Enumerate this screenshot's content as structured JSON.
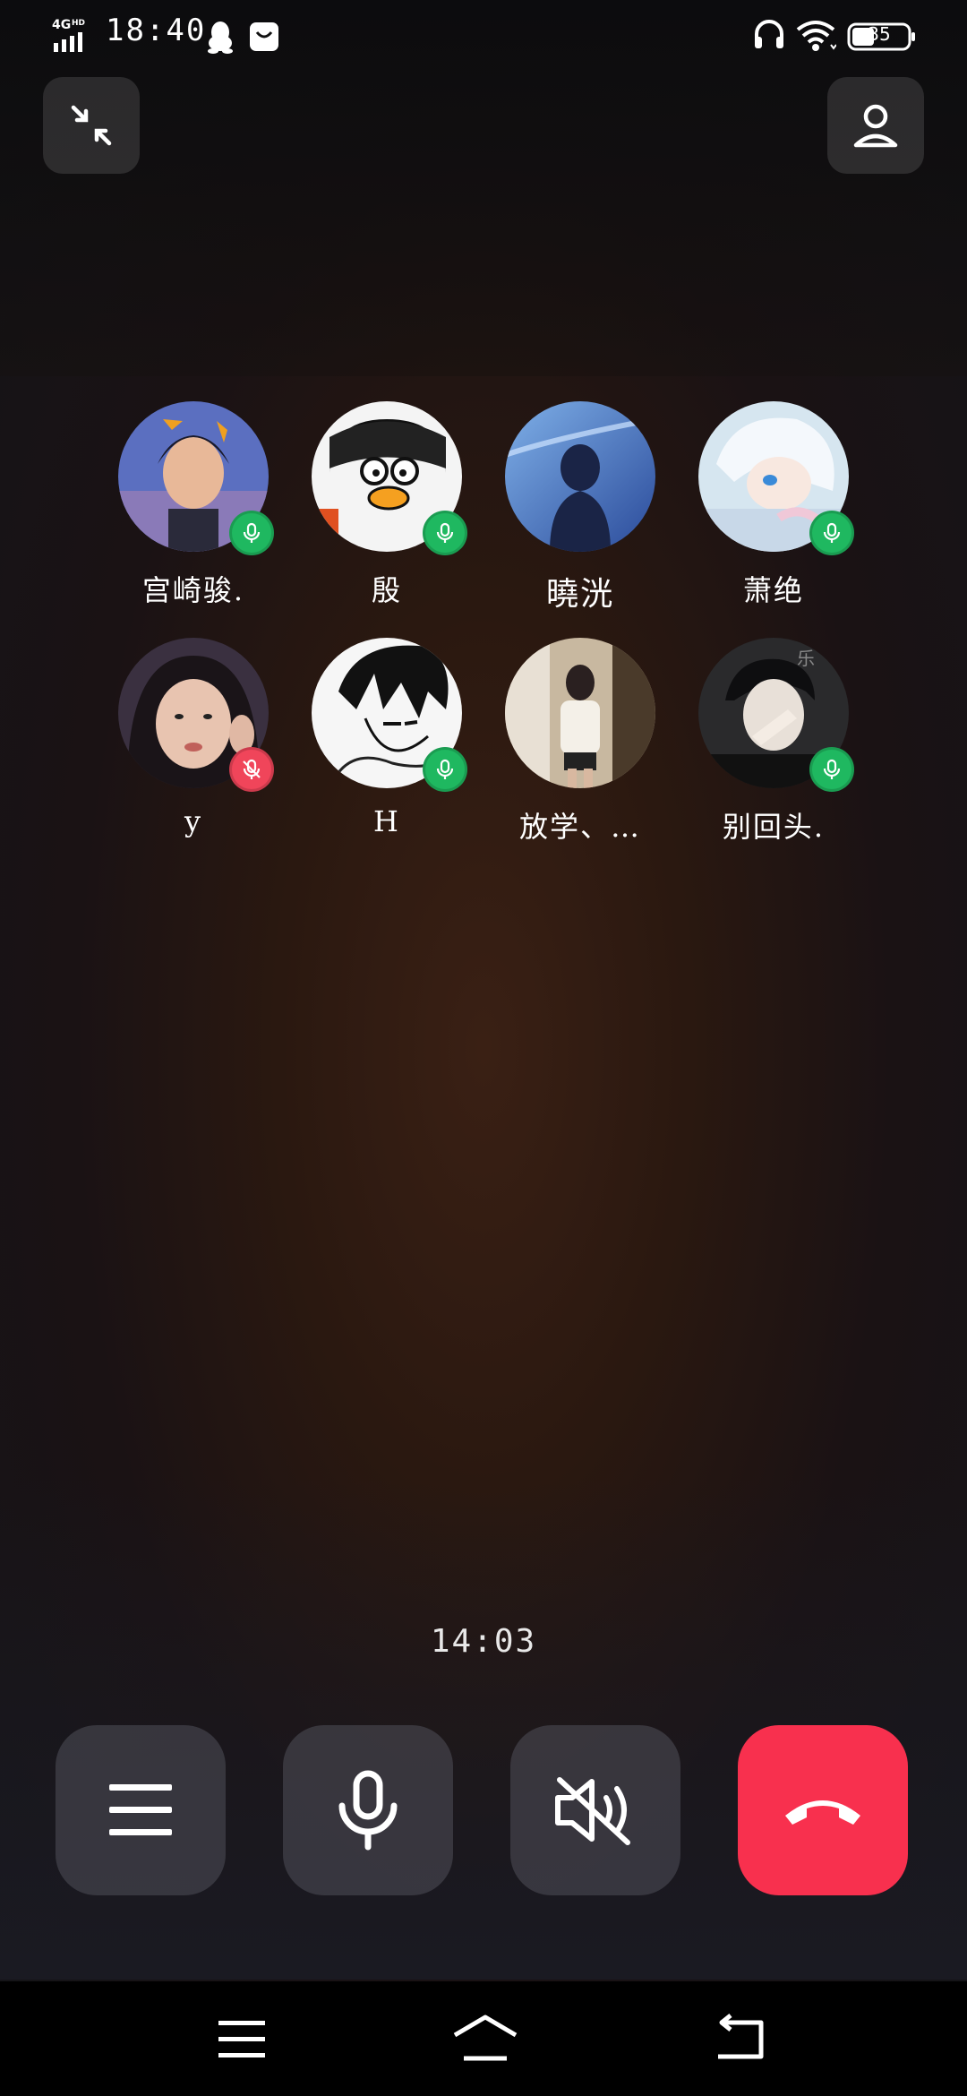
{
  "status_bar": {
    "network": "4G HD",
    "time": "18:40",
    "battery": "35",
    "icons": [
      "signal-icon",
      "qq-icon",
      "message-icon",
      "headset-icon",
      "wifi-icon",
      "battery-icon"
    ]
  },
  "top_bar": {
    "left_icon": "minimize-icon",
    "right_icon": "person-icon"
  },
  "participants": [
    {
      "name": "宫崎骏.",
      "mic": "on",
      "avatar": "anime-boy-orange"
    },
    {
      "name": "殷",
      "mic": "on",
      "avatar": "penguin-cartoon"
    },
    {
      "name": "曉洸",
      "mic": "none",
      "avatar": "anime-sky-boy"
    },
    {
      "name": "萧绝",
      "mic": "on",
      "avatar": "anime-white-hair"
    },
    {
      "name": "y",
      "mic": "off",
      "avatar": "girl-photo"
    },
    {
      "name": "H",
      "mic": "on",
      "avatar": "manga-boy"
    },
    {
      "name": "放学、…",
      "mic": "none",
      "avatar": "mirror-selfie"
    },
    {
      "name": "别回头.",
      "mic": "on",
      "avatar": "boy-photo"
    }
  ],
  "call": {
    "duration": "14:03"
  },
  "controls": [
    {
      "name": "menu",
      "icon": "hamburger-icon"
    },
    {
      "name": "microphone",
      "icon": "microphone-icon"
    },
    {
      "name": "speaker",
      "icon": "speaker-muted-icon"
    },
    {
      "name": "hang-up",
      "icon": "hang-up-icon"
    }
  ],
  "colors": {
    "mic_on": "#1fb860",
    "mic_off": "#f0455a",
    "hang_up": "#f8304e"
  },
  "nav_bar": [
    "menu-icon",
    "home-icon",
    "back-icon"
  ]
}
